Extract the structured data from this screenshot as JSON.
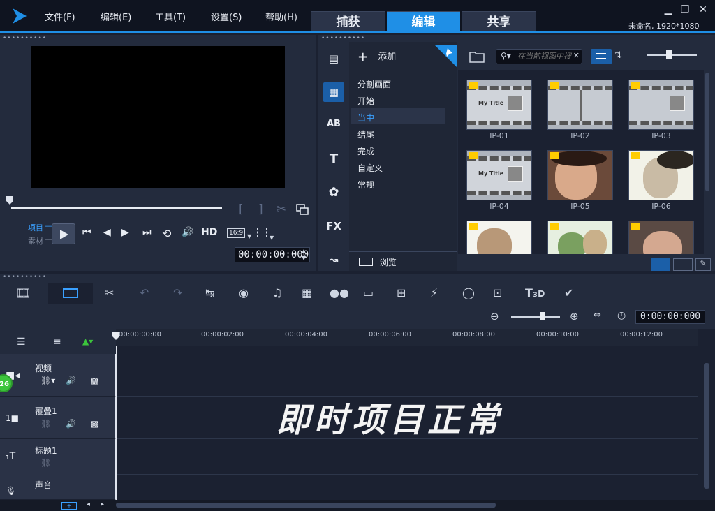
{
  "menu": {
    "file": "文件(F)",
    "edit": "编辑(E)",
    "tools": "工具(T)",
    "settings": "设置(S)",
    "help": "帮助(H)"
  },
  "tabs": {
    "capture": "捕获",
    "edit": "编辑",
    "share": "共享"
  },
  "project_info": "未命名, 1920*1080",
  "player": {
    "project_label": "项目",
    "clip_label": "素材",
    "hd_label": "HD",
    "aspect_label": "16:9",
    "timecode": "00:00:00:000"
  },
  "library": {
    "add_label": "添加",
    "search_placeholder": "在当前视图中搜",
    "browse_label": "浏览",
    "categories": [
      "分割画面",
      "开始",
      "当中",
      "结尾",
      "完成",
      "自定义",
      "常规"
    ],
    "active_category": "当中",
    "thumbs": [
      "IP-01",
      "IP-02",
      "IP-03",
      "IP-04",
      "IP-05",
      "IP-06"
    ],
    "thumb_title_text": "My Title"
  },
  "timeline": {
    "timecode": "0:00:00:000",
    "ruler": [
      "00:00:00:00",
      "00:00:02:00",
      "00:00:04:00",
      "00:00:06:00",
      "00:00:08:00",
      "00:00:10:00",
      "00:00:12:00"
    ],
    "tracks": [
      "视频",
      "覆叠1",
      "标题1",
      "声音"
    ],
    "overlay_text": "即时项目正常",
    "badge_count": "26"
  },
  "colors": {
    "accent": "#1f8fe6",
    "background": "#1b2131",
    "panel": "#232b3d"
  }
}
